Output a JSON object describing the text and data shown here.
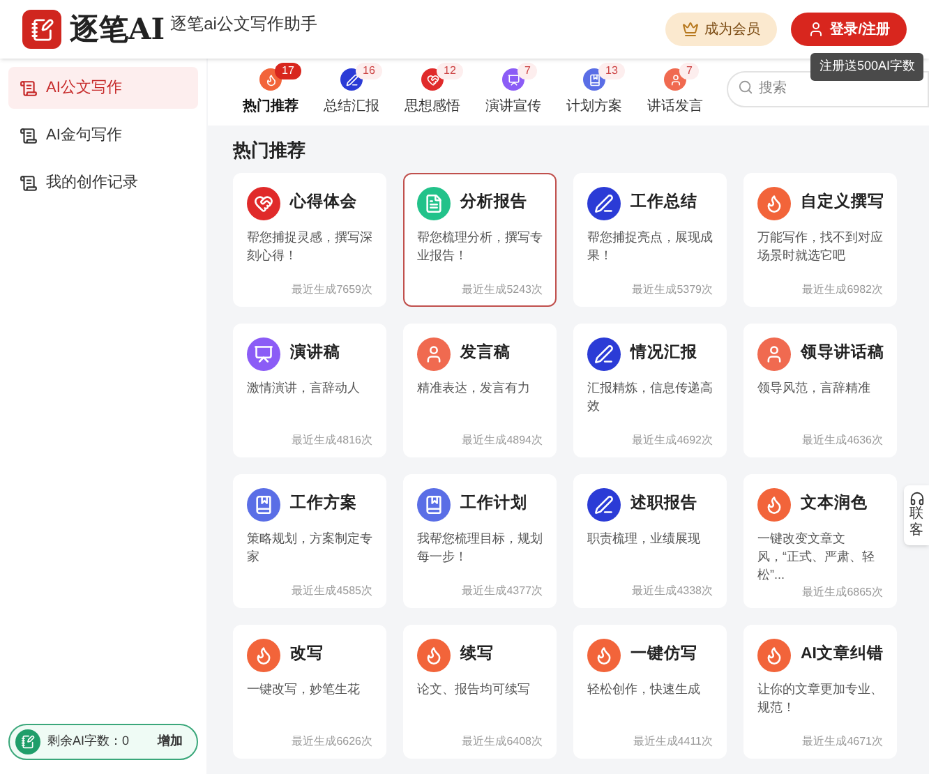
{
  "header": {
    "logo_text": "逐笔AI",
    "subtitle": "逐笔ai公文写作助手",
    "vip_button": "成为会员",
    "login_button": "登录/注册",
    "tooltip": "注册送500AI字数"
  },
  "sidebar": {
    "items": [
      {
        "label": "AI公文写作",
        "selected": true
      },
      {
        "label": "AI金句写作",
        "selected": false
      },
      {
        "label": "我的创作记录",
        "selected": false
      }
    ],
    "quota": {
      "label": "剩余AI字数：0",
      "button": "增加"
    }
  },
  "categories": [
    {
      "label": "热门推荐",
      "count": "17",
      "selected": true,
      "kind": "fire"
    },
    {
      "label": "总结汇报",
      "count": "16",
      "selected": false,
      "kind": "pen"
    },
    {
      "label": "思想感悟",
      "count": "12",
      "selected": false,
      "kind": "heart"
    },
    {
      "label": "演讲宣传",
      "count": "7",
      "selected": false,
      "kind": "easel"
    },
    {
      "label": "计划方案",
      "count": "13",
      "selected": false,
      "kind": "book"
    },
    {
      "label": "讲话发言",
      "count": "7",
      "selected": false,
      "kind": "person"
    }
  ],
  "search": {
    "placeholder": "搜索"
  },
  "section_title": "热门推荐",
  "cards": [
    {
      "title": "心得体会",
      "desc": "帮您捕捉灵感，撰写深刻心得！",
      "stat": "最近生成7659次",
      "kind": "heart",
      "selected": false
    },
    {
      "title": "分析报告",
      "desc": "帮您梳理分析，撰写专业报告！",
      "stat": "最近生成5243次",
      "kind": "doc",
      "selected": true
    },
    {
      "title": "工作总结",
      "desc": "帮您捕捉亮点，展现成果！",
      "stat": "最近生成5379次",
      "kind": "pen",
      "selected": false
    },
    {
      "title": "自定义撰写",
      "desc": "万能写作，找不到对应场景时就选它吧",
      "stat": "最近生成6982次",
      "kind": "fire",
      "selected": false
    },
    {
      "title": "演讲稿",
      "desc": "激情演讲，言辞动人",
      "stat": "最近生成4816次",
      "kind": "easel",
      "selected": false
    },
    {
      "title": "发言稿",
      "desc": "精准表达，发言有力",
      "stat": "最近生成4894次",
      "kind": "person",
      "selected": false
    },
    {
      "title": "情况汇报",
      "desc": "汇报精炼，信息传递高效",
      "stat": "最近生成4692次",
      "kind": "pen",
      "selected": false
    },
    {
      "title": "领导讲话稿",
      "desc": "领导风范，言辞精准",
      "stat": "最近生成4636次",
      "kind": "person",
      "selected": false
    },
    {
      "title": "工作方案",
      "desc": "策略规划，方案制定专家",
      "stat": "最近生成4585次",
      "kind": "book",
      "selected": false
    },
    {
      "title": "工作计划",
      "desc": "我帮您梳理目标，规划每一步！",
      "stat": "最近生成4377次",
      "kind": "book",
      "selected": false
    },
    {
      "title": "述职报告",
      "desc": "职责梳理，业绩展现",
      "stat": "最近生成4338次",
      "kind": "pen",
      "selected": false
    },
    {
      "title": "文本润色",
      "desc": "一键改变文章文风，“正式、严肃、轻松”...",
      "stat": "最近生成6865次",
      "kind": "fire",
      "selected": false
    },
    {
      "title": "改写",
      "desc": "一键改写，妙笔生花",
      "stat": "最近生成6626次",
      "kind": "fire",
      "selected": false
    },
    {
      "title": "续写",
      "desc": "论文、报告均可续写",
      "stat": "最近生成6408次",
      "kind": "fire",
      "selected": false
    },
    {
      "title": "一键仿写",
      "desc": "轻松创作，快速生成",
      "stat": "最近生成4411次",
      "kind": "fire",
      "selected": false
    },
    {
      "title": "AI文章纠错",
      "desc": "让你的文章更加专业、规范！",
      "stat": "最近生成4671次",
      "kind": "fire",
      "selected": false
    }
  ],
  "contact": {
    "lines": [
      "联",
      "客"
    ]
  }
}
